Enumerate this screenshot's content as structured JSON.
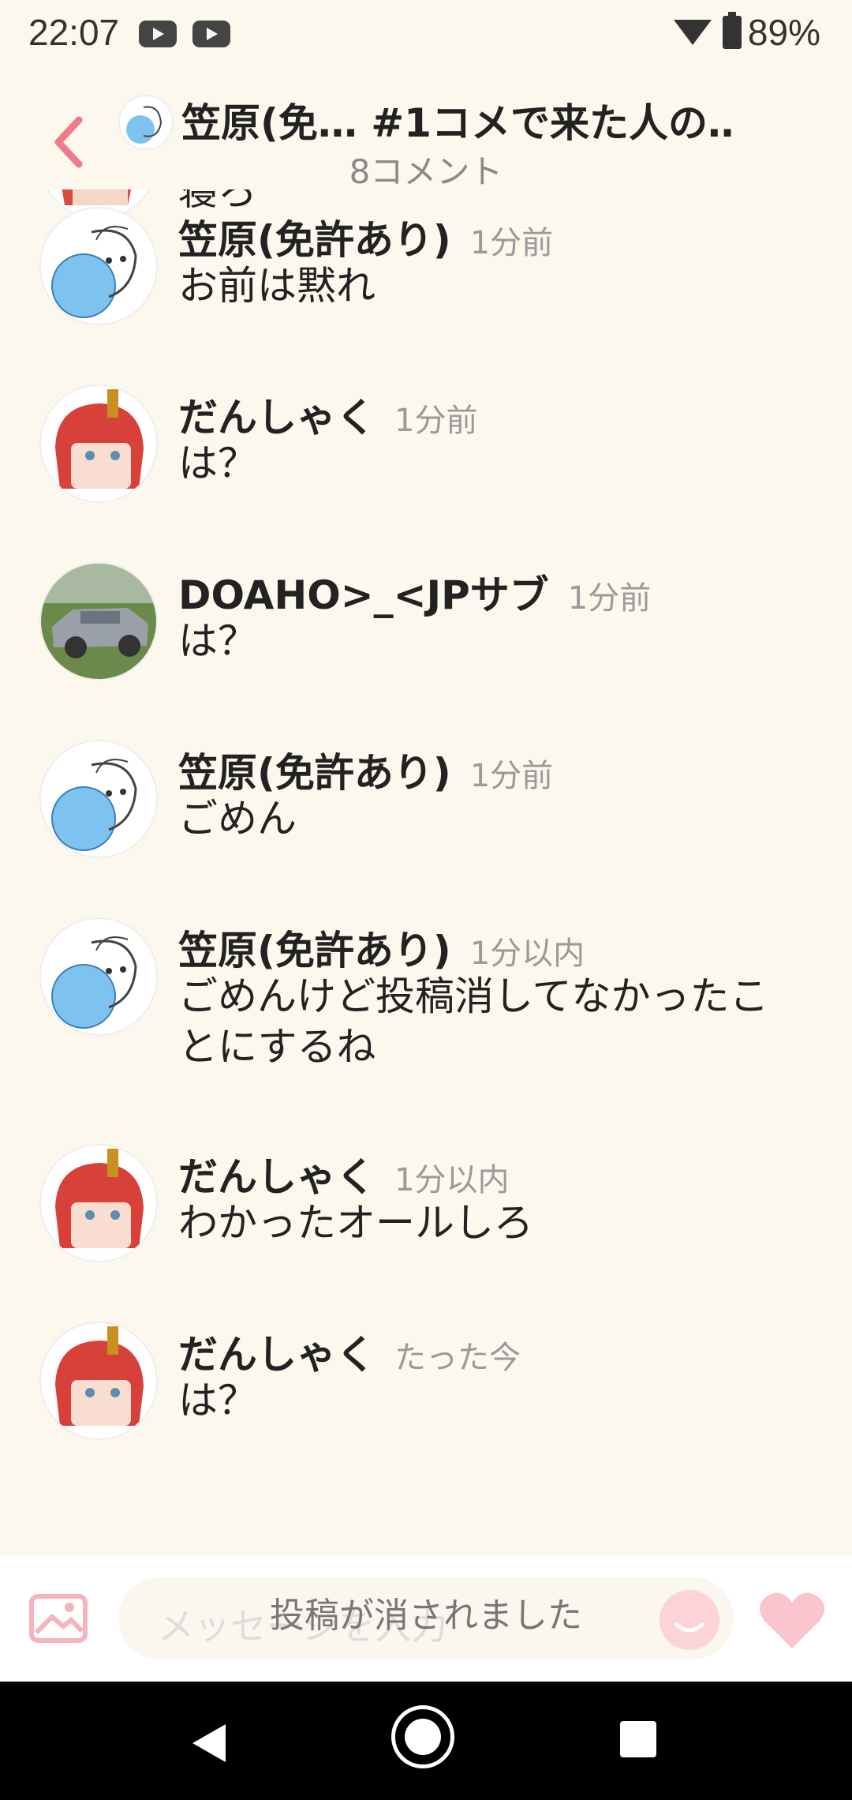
{
  "status_bar": {
    "time": "22:07",
    "battery": "89%"
  },
  "header": {
    "title": "笠原(免…  #1コメで来た人の…",
    "subtitle": "8コメント"
  },
  "partial_comment_text": "寝ろ",
  "comments": [
    {
      "name": "笠原(免許あり)",
      "time": "1分前",
      "text": "お前は黙れ",
      "avatar": "sketch-avatar"
    },
    {
      "name": "だんしゃく",
      "time": "1分前",
      "text": "は？",
      "avatar": "redhair-avatar"
    },
    {
      "name": "DOAHO>_<JPサブ",
      "time": "1分前",
      "text": "は？",
      "avatar": "car-avatar"
    },
    {
      "name": "笠原(免許あり)",
      "time": "1分前",
      "text": "ごめん",
      "avatar": "sketch-avatar"
    },
    {
      "name": "笠原(免許あり)",
      "time": "1分以内",
      "text": "ごめんけど投稿消してなかったことにするね",
      "avatar": "sketch-avatar"
    },
    {
      "name": "だんしゃく",
      "time": "1分以内",
      "text": "わかったオールしろ",
      "avatar": "redhair-avatar"
    },
    {
      "name": "だんしゃく",
      "time": "たった今",
      "text": "は？",
      "avatar": "redhair-avatar"
    }
  ],
  "input": {
    "placeholder": "メッセージを入力"
  },
  "toast": "投稿が消されました",
  "colors": {
    "accent": "#f07a8a",
    "background": "#fdf8ee",
    "heart": "#f9c4cc"
  }
}
